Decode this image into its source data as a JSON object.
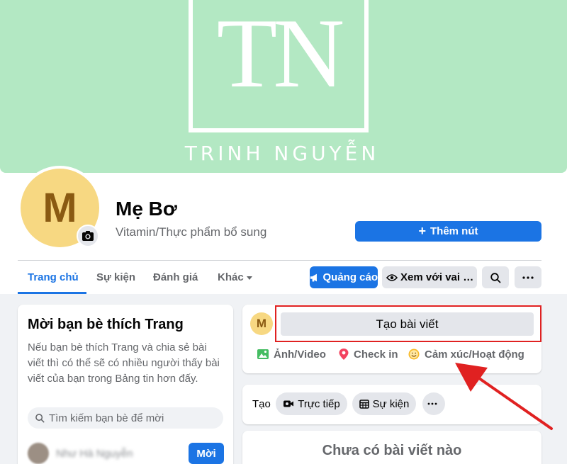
{
  "cover": {
    "logo_initials": "TN",
    "logo_name": "TRINH NGUYỄN"
  },
  "profile": {
    "avatar_letter": "M",
    "name": "Mẹ Bơ",
    "category": "Vitamin/Thực phẩm bổ sung",
    "add_button_label": "Thêm nút"
  },
  "tabs": [
    {
      "label": "Trang chủ",
      "active": true
    },
    {
      "label": "Sự kiện",
      "active": false
    },
    {
      "label": "Đánh giá",
      "active": false
    },
    {
      "label": "Khác",
      "active": false
    }
  ],
  "toolbar": {
    "ads_label": "Quảng cáo",
    "view_as_label": "Xem với vai trò"
  },
  "invite": {
    "title": "Mời bạn bè thích Trang",
    "description": "Nếu bạn bè thích Trang và chia sẻ bài viết thì có thể sẽ có nhiều người thấy bài viết của bạn trong Bảng tin hơn đấy.",
    "search_placeholder": "Tìm kiếm bạn bè để mời",
    "friend_name": "Như Hà Nguyễn",
    "invite_button": "Mời"
  },
  "composer": {
    "avatar_letter": "M",
    "prompt": "Tạo bài viết",
    "actions": [
      "Ảnh/Video",
      "Check in",
      "Cảm xúc/Hoạt động"
    ]
  },
  "create_bar": {
    "label": "Tạo",
    "buttons": [
      "Trực tiếp",
      "Sự kiện"
    ]
  },
  "empty_state": "Chưa có bài viết nào",
  "colors": {
    "accent": "#1b74e4",
    "cover": "#b3e8c3",
    "annotation": "#e02121"
  }
}
